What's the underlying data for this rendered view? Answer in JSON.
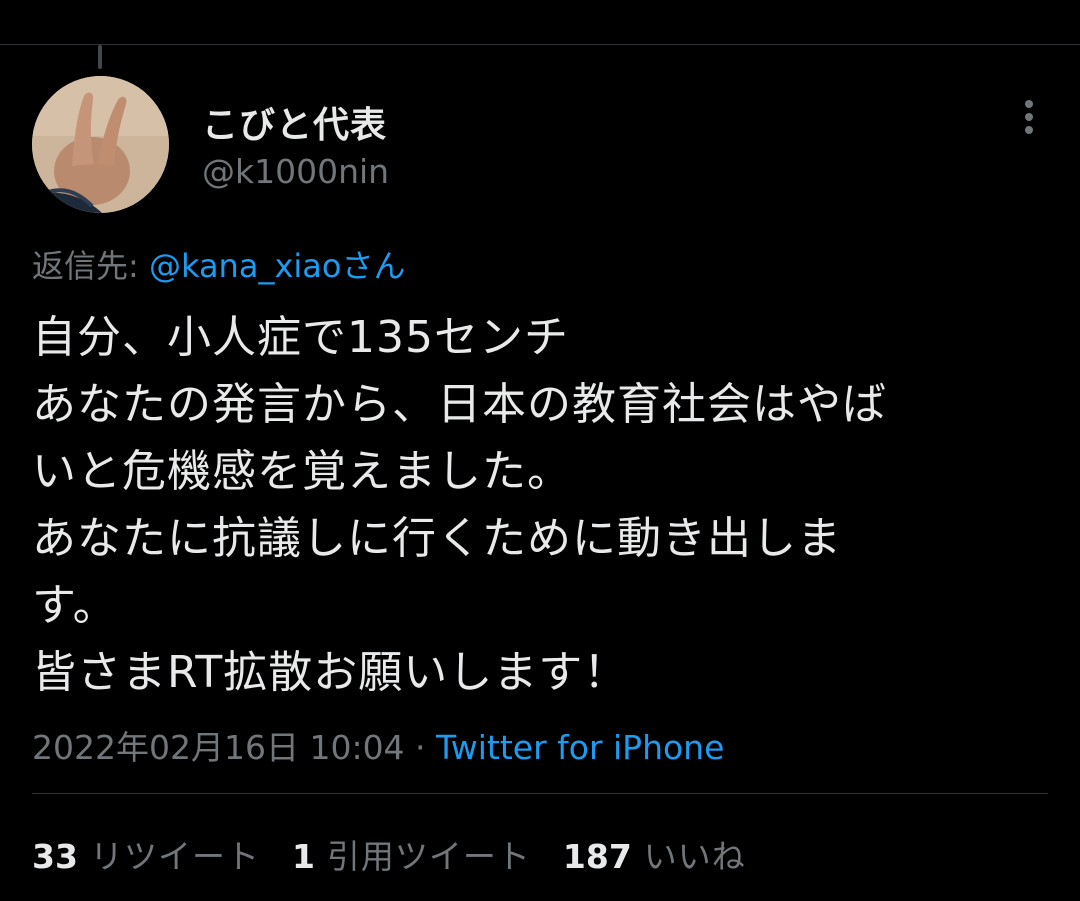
{
  "user": {
    "display_name": "こびと代表",
    "handle": "@k1000nin",
    "avatar_icon": "v-sign-hand-photo"
  },
  "reply": {
    "prefix": "返信先: ",
    "mention": "@kana_xiaoさん"
  },
  "tweet": {
    "lines": [
      "自分、小人症で135センチ",
      "あなたの発言から、日本の教育社会はやば",
      "いと危機感を覚えました。",
      "あなたに抗議しに行くために動き出しま",
      "す。",
      "皆さまRT拡散お願いします！"
    ]
  },
  "meta": {
    "timestamp": "2022年02月16日 10:04",
    "separator": " · ",
    "source": "Twitter for iPhone"
  },
  "stats": {
    "retweets_count": "33",
    "retweets_label": "リツイート",
    "quotes_count": "1",
    "quotes_label": "引用ツイート",
    "likes_count": "187",
    "likes_label": "いいね"
  },
  "icons": {
    "more": "more-vertical-icon"
  },
  "colors": {
    "background": "#000000",
    "text": "#e7e9ea",
    "secondary": "#71767b",
    "accent": "#1d9bf0",
    "divider": "#2f3336"
  }
}
